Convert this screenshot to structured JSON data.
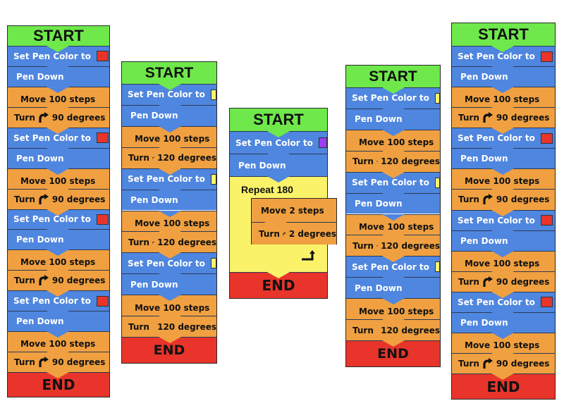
{
  "colors": {
    "start": "#6ee84b",
    "pen": "#4f86df",
    "motion": "#f0a040",
    "loop": "#faf36a",
    "end": "#e8342a",
    "red_swatch": "#e8342a",
    "yellow_swatch": "#faf36a",
    "purple_swatch": "#9b3df0"
  },
  "labels": {
    "start": "START",
    "end": "END",
    "set_pen": "Set Pen Color to",
    "pen_down": "Pen Down",
    "move_100": "Move 100 steps",
    "move_2": "Move 2 steps",
    "turn": "Turn",
    "deg_90": "90 degrees",
    "deg_120": "120 degrees",
    "deg_2": "2 degrees",
    "repeat": "Repeat 180"
  },
  "programs": [
    {
      "id": "square-left",
      "shape": "square",
      "pen_color": "red",
      "turn_degrees": 90,
      "move_steps": 100,
      "sides": 4
    },
    {
      "id": "triangle-left",
      "shape": "triangle",
      "pen_color": "yellow",
      "turn_degrees": 120,
      "move_steps": 100,
      "sides": 3,
      "last_turn_icon": false
    },
    {
      "id": "circle-center",
      "shape": "repeat",
      "pen_color": "purple",
      "repeat_count": 180,
      "move_steps": 2,
      "turn_degrees": 2
    },
    {
      "id": "triangle-right",
      "shape": "triangle",
      "pen_color": "yellow",
      "turn_degrees": 120,
      "move_steps": 100,
      "sides": 3,
      "last_turn_icon": false
    },
    {
      "id": "square-right",
      "shape": "square",
      "pen_color": "red",
      "turn_degrees": 90,
      "move_steps": 100,
      "sides": 4
    }
  ]
}
